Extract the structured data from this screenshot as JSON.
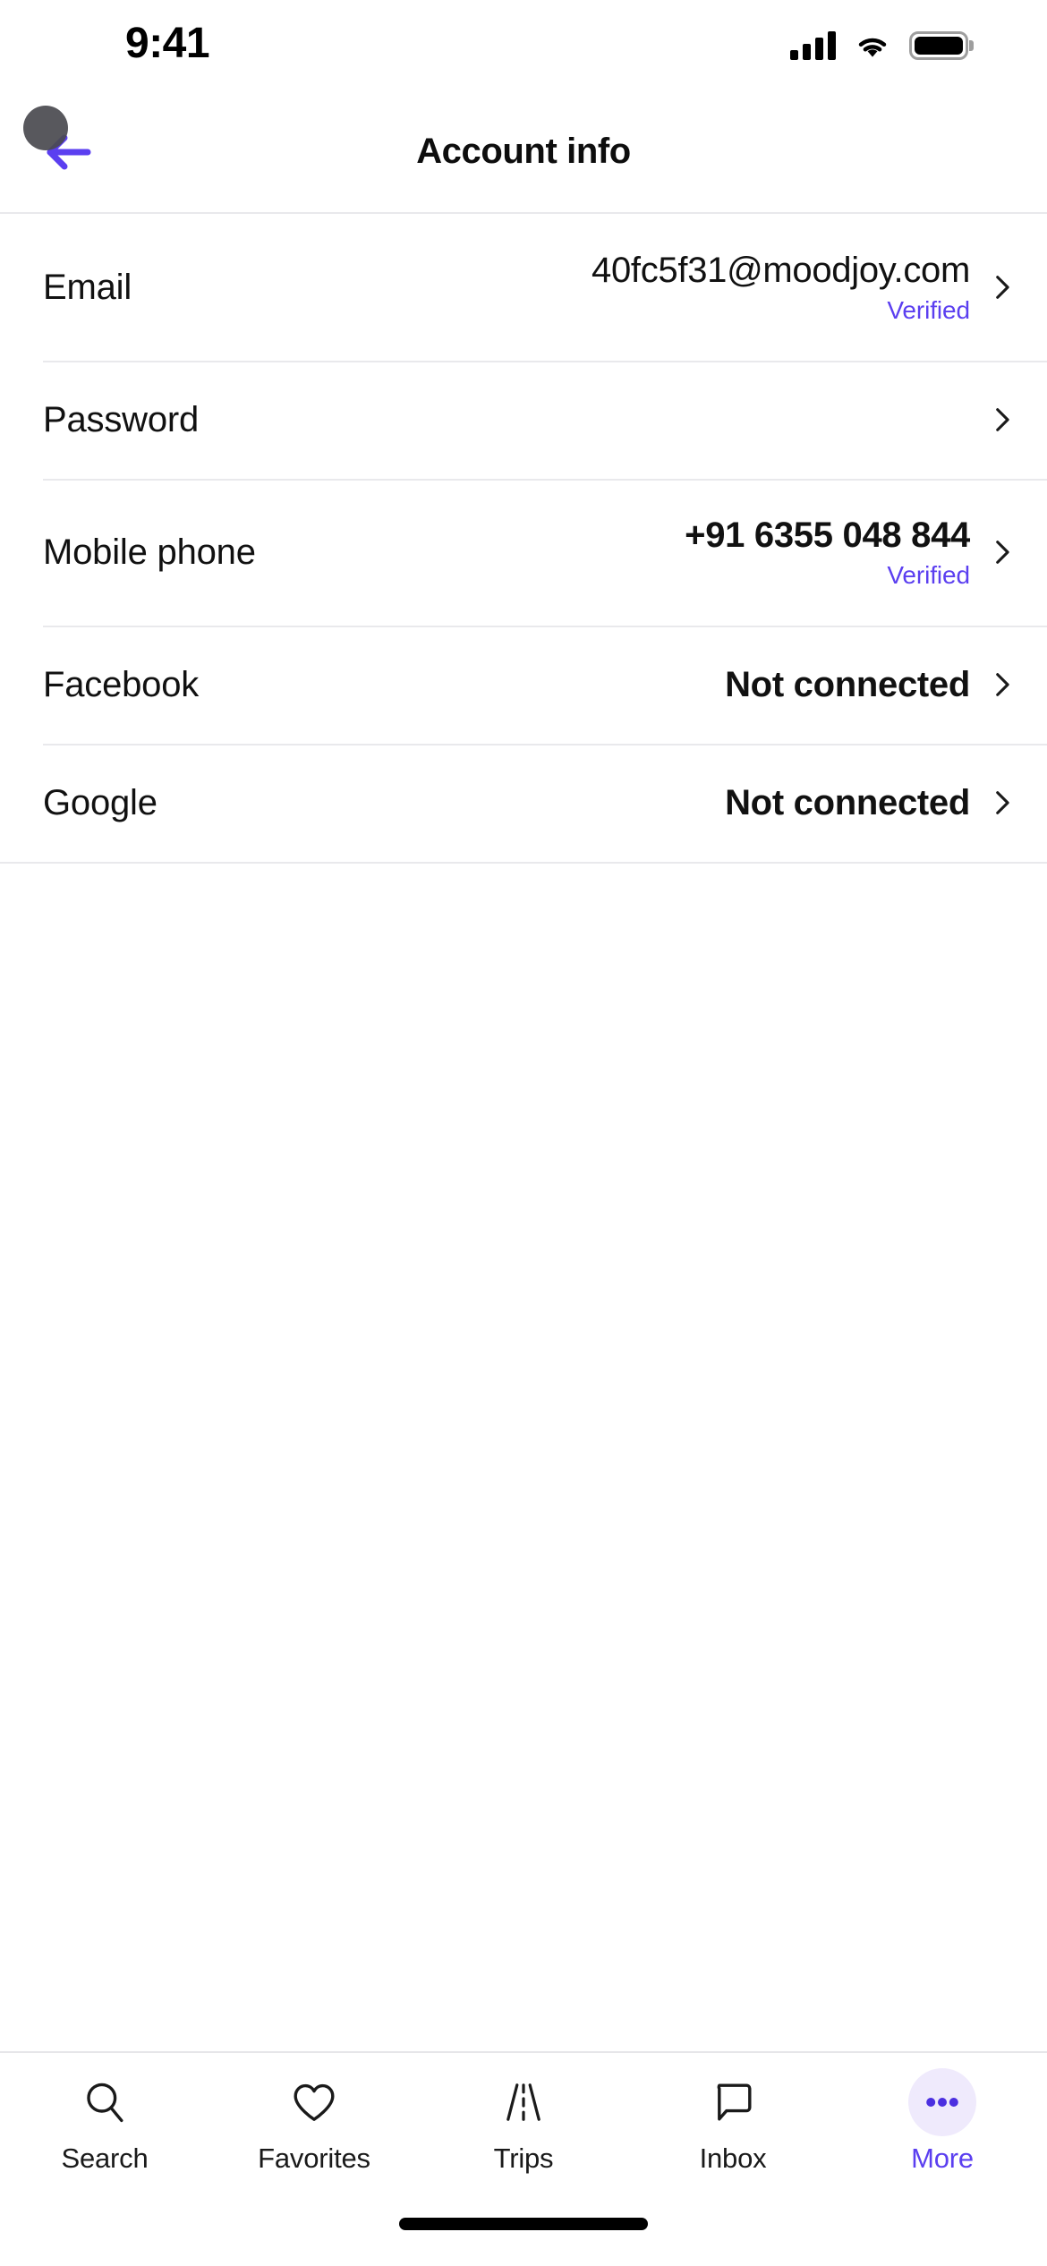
{
  "status_bar": {
    "time": "9:41",
    "signal_icon": "cellular-signal-icon",
    "wifi_icon": "wifi-icon",
    "battery_icon": "battery-full-icon"
  },
  "nav": {
    "title": "Account info",
    "back_icon": "back-arrow-icon"
  },
  "colors": {
    "accent": "#5b3ff0",
    "accent_soft": "#efeafc",
    "text": "#111111",
    "divider": "#e9e9ec",
    "cursor": "#4a4a4f"
  },
  "list": {
    "rows": [
      {
        "label": "Email",
        "value": "40fc5f31@moodjoy.com",
        "sub": "Verified",
        "chevron": "chevron-right-icon"
      },
      {
        "label": "Password",
        "value": "",
        "sub": "",
        "chevron": "chevron-right-icon"
      },
      {
        "label": "Mobile phone",
        "value": "+91 6355 048 844",
        "sub": "Verified",
        "chevron": "chevron-right-icon"
      },
      {
        "label": "Facebook",
        "value": "Not connected",
        "sub": "",
        "chevron": "chevron-right-icon"
      },
      {
        "label": "Google",
        "value": "Not connected",
        "sub": "",
        "chevron": "chevron-right-icon"
      }
    ]
  },
  "tab_bar": {
    "tabs": [
      {
        "label": "Search",
        "icon": "search-icon",
        "active": false
      },
      {
        "label": "Favorites",
        "icon": "heart-icon",
        "active": false
      },
      {
        "label": "Trips",
        "icon": "road-icon",
        "active": false
      },
      {
        "label": "Inbox",
        "icon": "chat-bubble-icon",
        "active": false
      },
      {
        "label": "More",
        "icon": "ellipsis-icon",
        "active": true
      }
    ]
  }
}
